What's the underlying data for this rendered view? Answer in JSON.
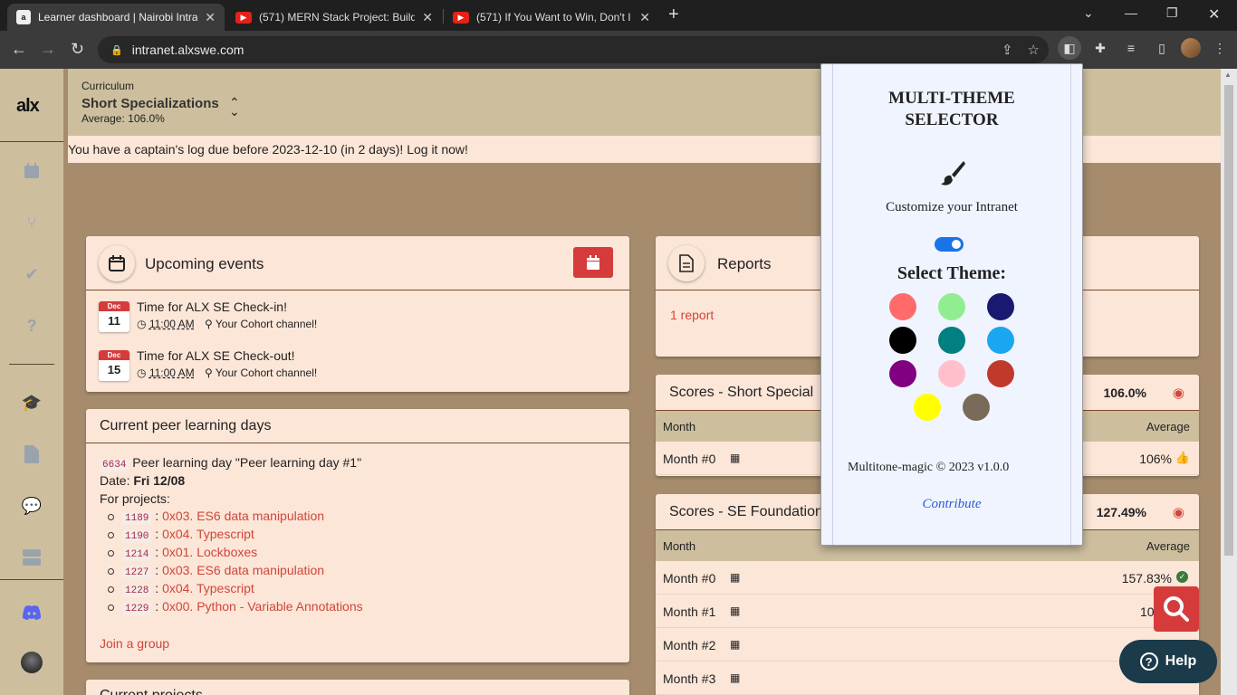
{
  "browser": {
    "tabs": [
      {
        "title": "Learner dashboard | Nairobi Intra",
        "favicon": "alx"
      },
      {
        "title": "(571) MERN Stack Project: Build",
        "favicon": "youtube"
      },
      {
        "title": "(571) If You Want to Win, Don't I",
        "favicon": "youtube"
      }
    ],
    "url": "intranet.alxswe.com"
  },
  "sidebar": {
    "logo": "alx",
    "items": [
      "calendar-icon",
      "fork-icon",
      "check-icon",
      "question-icon",
      "graduation-icon",
      "file-icon",
      "chat-icon",
      "server-icon",
      "discord-icon",
      "user-avatar"
    ]
  },
  "header": {
    "label": "Curriculum",
    "title": "Short Specializations",
    "average": "Average: 106.0%"
  },
  "alert": "You have a captain's log due before 2023-12-10 (in 2 days)! Log it now!",
  "events": {
    "title": "Upcoming events",
    "items": [
      {
        "month": "Dec",
        "day": "11",
        "title": "Time for ALX SE Check-in!",
        "time": "11:00 AM",
        "place": "Your Cohort channel!"
      },
      {
        "month": "Dec",
        "day": "15",
        "title": "Time for ALX SE Check-out!",
        "time": "11:00 AM",
        "place": "Your Cohort channel!"
      }
    ]
  },
  "peer": {
    "title": "Current peer learning days",
    "id": "6634",
    "name": "Peer learning day \"Peer learning day #1\"",
    "date_label": "Date:",
    "date": "Fri 12/08",
    "for_projects": "For projects:",
    "projects": [
      {
        "id": "1189",
        "name": "0x03. ES6 data manipulation"
      },
      {
        "id": "1190",
        "name": "0x04. Typescript"
      },
      {
        "id": "1214",
        "name": "0x01. Lockboxes"
      },
      {
        "id": "1227",
        "name": "0x03. ES6 data manipulation"
      },
      {
        "id": "1228",
        "name": "0x04. Typescript"
      },
      {
        "id": "1229",
        "name": "0x00. Python - Variable Annotations"
      }
    ],
    "join": "Join a group"
  },
  "current_projects_title": "Current projects",
  "reports": {
    "title": "Reports",
    "link": "1 report"
  },
  "scores_short": {
    "title": "Scores - Short Special",
    "pct": "106.0%",
    "col_month": "Month",
    "col_avg": "Average",
    "rows": [
      {
        "month": "Month #0",
        "avg": "106%"
      }
    ]
  },
  "scores_found": {
    "title": "Scores - SE Foundation",
    "pct": "127.49%",
    "col_month": "Month",
    "col_avg": "Average",
    "rows": [
      {
        "month": "Month #0",
        "avg": "157.83%"
      },
      {
        "month": "Month #1",
        "avg": "105.2"
      },
      {
        "month": "Month #2",
        "avg": "1"
      },
      {
        "month": "Month #3",
        "avg": "1"
      }
    ]
  },
  "popup": {
    "title": "MULTI-THEME SELECTOR",
    "subtitle": "Customize your Intranet",
    "select_theme": "Select Theme:",
    "swatches": [
      "#ff6b6b",
      "#90ee90",
      "#191970",
      "#000000",
      "#008080",
      "#1aa7f0",
      "#800080",
      "#ffc0cb",
      "#c0392b",
      "#ffff00",
      "#7a6a5a"
    ],
    "footer": "Multitone-magic © 2023 v1.0.0",
    "contribute": "Contribute"
  },
  "help": "Help",
  "colors": {
    "accent": "#d63b3b",
    "bg": "#a68c6d",
    "card": "#fce6d8",
    "header": "#cdbf9e"
  }
}
